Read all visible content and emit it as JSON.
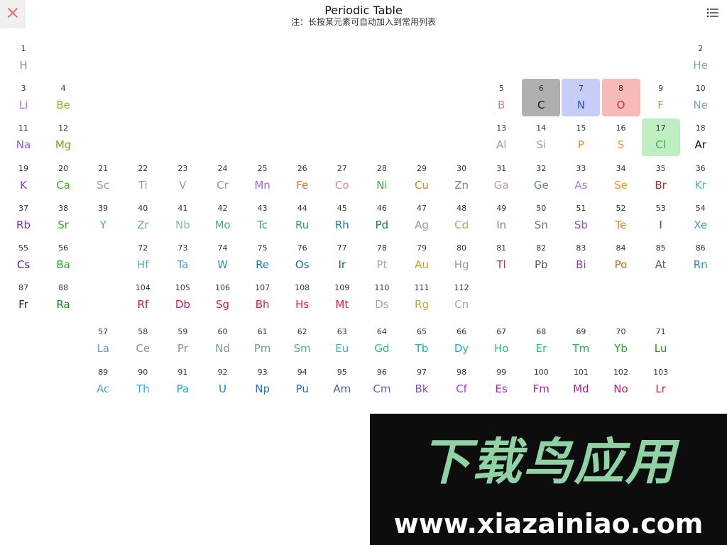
{
  "header": {
    "title": "Periodic Table",
    "subtitle": "注：长按某元素可自动加入到常用列表"
  },
  "icons": {
    "close": "close-icon",
    "menu": "list-menu-icon"
  },
  "colors": {
    "close_icon": "#e25c5c",
    "selected_C": "#b0b0b0",
    "selected_N": "#c6cdf7",
    "selected_O": "#f7b9b9",
    "selected_Cl": "#bfeec3"
  },
  "elements": [
    {
      "n": "1",
      "s": "H",
      "c": "#8a8a8a",
      "g": 1,
      "p": 1
    },
    {
      "n": "2",
      "s": "He",
      "c": "#7aa6b3",
      "g": 18,
      "p": 1
    },
    {
      "n": "3",
      "s": "Li",
      "c": "#b36bd6",
      "g": 1,
      "p": 2
    },
    {
      "n": "4",
      "s": "Be",
      "c": "#8fae1b",
      "g": 2,
      "p": 2
    },
    {
      "n": "5",
      "s": "B",
      "c": "#c48a8a",
      "g": 13,
      "p": 2
    },
    {
      "n": "6",
      "s": "C",
      "c": "#111111",
      "g": 14,
      "p": 2,
      "hl": "#b0b0b0"
    },
    {
      "n": "7",
      "s": "N",
      "c": "#2f4fd6",
      "g": 15,
      "p": 2,
      "hl": "#c6cdf7"
    },
    {
      "n": "8",
      "s": "O",
      "c": "#d62f2f",
      "g": 16,
      "p": 2,
      "hl": "#f7b9b9"
    },
    {
      "n": "9",
      "s": "F",
      "c": "#79c23d",
      "g": 17,
      "p": 2
    },
    {
      "n": "10",
      "s": "Ne",
      "c": "#7aa6b3",
      "g": 18,
      "p": 2
    },
    {
      "n": "11",
      "s": "Na",
      "c": "#9a4fd6",
      "g": 1,
      "p": 3
    },
    {
      "n": "12",
      "s": "Mg",
      "c": "#6aa81b",
      "g": 2,
      "p": 3
    },
    {
      "n": "13",
      "s": "Al",
      "c": "#9a9a9a",
      "g": 13,
      "p": 3
    },
    {
      "n": "14",
      "s": "Si",
      "c": "#a8a08a",
      "g": 14,
      "p": 3
    },
    {
      "n": "15",
      "s": "P",
      "c": "#f08a1b",
      "g": 15,
      "p": 3
    },
    {
      "n": "16",
      "s": "S",
      "c": "#d6a11b",
      "g": 16,
      "p": 3
    },
    {
      "n": "17",
      "s": "Cl",
      "c": "#3fae3f",
      "g": 17,
      "p": 3,
      "hl": "#bfeec3"
    },
    {
      "n": "18",
      "s": "Ar",
      "c": "#111111",
      "g": 18,
      "p": 3
    },
    {
      "n": "19",
      "s": "K",
      "c": "#8a3fc4",
      "g": 1,
      "p": 4
    },
    {
      "n": "20",
      "s": "Ca",
      "c": "#3fae1b",
      "g": 2,
      "p": 4
    },
    {
      "n": "21",
      "s": "Sc",
      "c": "#9a9a9a",
      "g": 3,
      "p": 4
    },
    {
      "n": "22",
      "s": "Ti",
      "c": "#9a9a9a",
      "g": 4,
      "p": 4
    },
    {
      "n": "23",
      "s": "V",
      "c": "#9a9a9a",
      "g": 5,
      "p": 4
    },
    {
      "n": "24",
      "s": "Cr",
      "c": "#8a9aaa",
      "g": 6,
      "p": 4
    },
    {
      "n": "25",
      "s": "Mn",
      "c": "#9a6ac4",
      "g": 7,
      "p": 4
    },
    {
      "n": "26",
      "s": "Fe",
      "c": "#e0702f",
      "g": 8,
      "p": 4
    },
    {
      "n": "27",
      "s": "Co",
      "c": "#e08aa0",
      "g": 9,
      "p": 4
    },
    {
      "n": "28",
      "s": "Ni",
      "c": "#3fae3f",
      "g": 10,
      "p": 4
    },
    {
      "n": "29",
      "s": "Cu",
      "c": "#c88a2f",
      "g": 11,
      "p": 4
    },
    {
      "n": "30",
      "s": "Zn",
      "c": "#7a80a6",
      "g": 12,
      "p": 4
    },
    {
      "n": "31",
      "s": "Ga",
      "c": "#c49a9a",
      "g": 13,
      "p": 4
    },
    {
      "n": "32",
      "s": "Ge",
      "c": "#6a8a8a",
      "g": 14,
      "p": 4
    },
    {
      "n": "33",
      "s": "As",
      "c": "#b07ad6",
      "g": 15,
      "p": 4
    },
    {
      "n": "34",
      "s": "Se",
      "c": "#f09a1b",
      "g": 16,
      "p": 4
    },
    {
      "n": "35",
      "s": "Br",
      "c": "#a62f2f",
      "g": 17,
      "p": 4
    },
    {
      "n": "36",
      "s": "Kr",
      "c": "#4fb3c4",
      "g": 18,
      "p": 4
    },
    {
      "n": "37",
      "s": "Rb",
      "c": "#7a2fa6",
      "g": 1,
      "p": 5
    },
    {
      "n": "38",
      "s": "Sr",
      "c": "#2fae1b",
      "g": 2,
      "p": 5
    },
    {
      "n": "39",
      "s": "Y",
      "c": "#5aa6a6",
      "g": 3,
      "p": 5
    },
    {
      "n": "40",
      "s": "Zr",
      "c": "#6aa6a6",
      "g": 4,
      "p": 5
    },
    {
      "n": "41",
      "s": "Nb",
      "c": "#8ab3c4",
      "g": 5,
      "p": 5
    },
    {
      "n": "42",
      "s": "Mo",
      "c": "#4fa6a6",
      "g": 6,
      "p": 5
    },
    {
      "n": "43",
      "s": "Tc",
      "c": "#3f9ab3",
      "g": 7,
      "p": 5
    },
    {
      "n": "44",
      "s": "Ru",
      "c": "#2f8aa6",
      "g": 8,
      "p": 5
    },
    {
      "n": "45",
      "s": "Rh",
      "c": "#1b7a99",
      "g": 9,
      "p": 5
    },
    {
      "n": "46",
      "s": "Pd",
      "c": "#1b6a8a",
      "g": 10,
      "p": 5
    },
    {
      "n": "47",
      "s": "Ag",
      "c": "#9a9a9a",
      "g": 11,
      "p": 5
    },
    {
      "n": "48",
      "s": "Cd",
      "c": "#c4a06a",
      "g": 12,
      "p": 5
    },
    {
      "n": "49",
      "s": "In",
      "c": "#a67a7a",
      "g": 13,
      "p": 5
    },
    {
      "n": "50",
      "s": "Sn",
      "c": "#6a7a7a",
      "g": 14,
      "p": 5
    },
    {
      "n": "51",
      "s": "Sb",
      "c": "#9a4fb3",
      "g": 15,
      "p": 5
    },
    {
      "n": "52",
      "s": "Te",
      "c": "#d68a1b",
      "g": 16,
      "p": 5
    },
    {
      "n": "53",
      "s": "I",
      "c": "#8a1b8a",
      "g": 17,
      "p": 5
    },
    {
      "n": "54",
      "s": "Xe",
      "c": "#3f9ab3",
      "g": 18,
      "p": 5
    },
    {
      "n": "55",
      "s": "Cs",
      "c": "#5a1b8a",
      "g": 1,
      "p": 6
    },
    {
      "n": "56",
      "s": "Ba",
      "c": "#1bae1b",
      "g": 2,
      "p": 6
    },
    {
      "n": "72",
      "s": "Hf",
      "c": "#4fb3e0",
      "g": 4,
      "p": 6
    },
    {
      "n": "73",
      "s": "Ta",
      "c": "#3fa6d6",
      "g": 5,
      "p": 6
    },
    {
      "n": "74",
      "s": "W",
      "c": "#2f8ac4",
      "g": 6,
      "p": 6
    },
    {
      "n": "75",
      "s": "Re",
      "c": "#1b7ab3",
      "g": 7,
      "p": 6
    },
    {
      "n": "76",
      "s": "Os",
      "c": "#1b6aa6",
      "g": 8,
      "p": 6
    },
    {
      "n": "77",
      "s": "Ir",
      "c": "#1b5a8a",
      "g": 9,
      "p": 6
    },
    {
      "n": "78",
      "s": "Pt",
      "c": "#a6a6a6",
      "g": 10,
      "p": 6
    },
    {
      "n": "79",
      "s": "Au",
      "c": "#c4a01b",
      "g": 11,
      "p": 6
    },
    {
      "n": "80",
      "s": "Hg",
      "c": "#9a9aa6",
      "g": 12,
      "p": 6
    },
    {
      "n": "81",
      "s": "Tl",
      "c": "#a63f3f",
      "g": 13,
      "p": 6
    },
    {
      "n": "82",
      "s": "Pb",
      "c": "#555a6a",
      "g": 14,
      "p": 6
    },
    {
      "n": "83",
      "s": "Bi",
      "c": "#8a3fa6",
      "g": 15,
      "p": 6
    },
    {
      "n": "84",
      "s": "Po",
      "c": "#b3701b",
      "g": 16,
      "p": 6
    },
    {
      "n": "85",
      "s": "At",
      "c": "#6a5a4f",
      "g": 17,
      "p": 6
    },
    {
      "n": "86",
      "s": "Rn",
      "c": "#2f8aa6",
      "g": 18,
      "p": 6
    },
    {
      "n": "87",
      "s": "Fr",
      "c": "#4f0a6a",
      "g": 1,
      "p": 7
    },
    {
      "n": "88",
      "s": "Ra",
      "c": "#0a8a1b",
      "g": 2,
      "p": 7
    },
    {
      "n": "104",
      "s": "Rf",
      "c": "#c41b4f",
      "g": 4,
      "p": 7
    },
    {
      "n": "105",
      "s": "Db",
      "c": "#c41b5a",
      "g": 5,
      "p": 7
    },
    {
      "n": "106",
      "s": "Sg",
      "c": "#d61b3f",
      "g": 6,
      "p": 7
    },
    {
      "n": "107",
      "s": "Bh",
      "c": "#e01b3f",
      "g": 7,
      "p": 7
    },
    {
      "n": "108",
      "s": "Hs",
      "c": "#e01b4f",
      "g": 8,
      "p": 7
    },
    {
      "n": "109",
      "s": "Mt",
      "c": "#e01b2f",
      "g": 9,
      "p": 7
    },
    {
      "n": "110",
      "s": "Ds",
      "c": "#a6a6a6",
      "g": 10,
      "p": 7
    },
    {
      "n": "111",
      "s": "Rg",
      "c": "#c4aa3f",
      "g": 11,
      "p": 7
    },
    {
      "n": "112",
      "s": "Cn",
      "c": "#a6a6b0",
      "g": 12,
      "p": 7
    },
    {
      "n": "57",
      "s": "La",
      "c": "#5a9ad6",
      "g": 3,
      "p": 9
    },
    {
      "n": "58",
      "s": "Ce",
      "c": "#8a9a7a",
      "g": 4,
      "p": 9
    },
    {
      "n": "59",
      "s": "Pr",
      "c": "#7a9a7a",
      "g": 5,
      "p": 9
    },
    {
      "n": "60",
      "s": "Nd",
      "c": "#7a9a8a",
      "g": 6,
      "p": 9
    },
    {
      "n": "61",
      "s": "Pm",
      "c": "#6aa68a",
      "g": 7,
      "p": 9
    },
    {
      "n": "62",
      "s": "Sm",
      "c": "#5aa69a",
      "g": 8,
      "p": 9
    },
    {
      "n": "63",
      "s": "Eu",
      "c": "#3fb3a6",
      "g": 9,
      "p": 9
    },
    {
      "n": "64",
      "s": "Gd",
      "c": "#2fb38a",
      "g": 10,
      "p": 9
    },
    {
      "n": "65",
      "s": "Tb",
      "c": "#1bb3a0",
      "g": 11,
      "p": 9
    },
    {
      "n": "66",
      "s": "Dy",
      "c": "#1bb3b3",
      "g": 12,
      "p": 9
    },
    {
      "n": "67",
      "s": "Ho",
      "c": "#1bc48a",
      "g": 13,
      "p": 9
    },
    {
      "n": "68",
      "s": "Er",
      "c": "#1bc47a",
      "g": 14,
      "p": 9
    },
    {
      "n": "69",
      "s": "Tm",
      "c": "#1bb34f",
      "g": 15,
      "p": 9
    },
    {
      "n": "70",
      "s": "Yb",
      "c": "#1bae1b",
      "g": 16,
      "p": 9
    },
    {
      "n": "71",
      "s": "Lu",
      "c": "#1b9a1b",
      "g": 17,
      "p": 9
    },
    {
      "n": "89",
      "s": "Ac",
      "c": "#4fa6d6",
      "g": 3,
      "p": 10
    },
    {
      "n": "90",
      "s": "Th",
      "c": "#1bb3e0",
      "g": 4,
      "p": 10
    },
    {
      "n": "91",
      "s": "Pa",
      "c": "#1ba6d6",
      "g": 5,
      "p": 10
    },
    {
      "n": "92",
      "s": "U",
      "c": "#1b8ad6",
      "g": 6,
      "p": 10
    },
    {
      "n": "93",
      "s": "Np",
      "c": "#1b7ad6",
      "g": 7,
      "p": 10
    },
    {
      "n": "94",
      "s": "Pu",
      "c": "#1b6ac4",
      "g": 8,
      "p": 10
    },
    {
      "n": "95",
      "s": "Am",
      "c": "#4f5ac4",
      "g": 9,
      "p": 10
    },
    {
      "n": "96",
      "s": "Cm",
      "c": "#6a5ac4",
      "g": 10,
      "p": 10
    },
    {
      "n": "97",
      "s": "Bk",
      "c": "#8a4fc4",
      "g": 11,
      "p": 10
    },
    {
      "n": "98",
      "s": "Cf",
      "c": "#9a3fc4",
      "g": 12,
      "p": 10
    },
    {
      "n": "99",
      "s": "Es",
      "c": "#b31bc4",
      "g": 13,
      "p": 10
    },
    {
      "n": "100",
      "s": "Fm",
      "c": "#b31bb3",
      "g": 14,
      "p": 10
    },
    {
      "n": "101",
      "s": "Md",
      "c": "#a61ba6",
      "g": 15,
      "p": 10
    },
    {
      "n": "102",
      "s": "No",
      "c": "#c41b8a",
      "g": 16,
      "p": 10
    },
    {
      "n": "103",
      "s": "Lr",
      "c": "#c41b6a",
      "g": 17,
      "p": 10
    }
  ],
  "watermark": {
    "brand": "下载鸟应用",
    "url": "www.xiazainiao.com"
  }
}
